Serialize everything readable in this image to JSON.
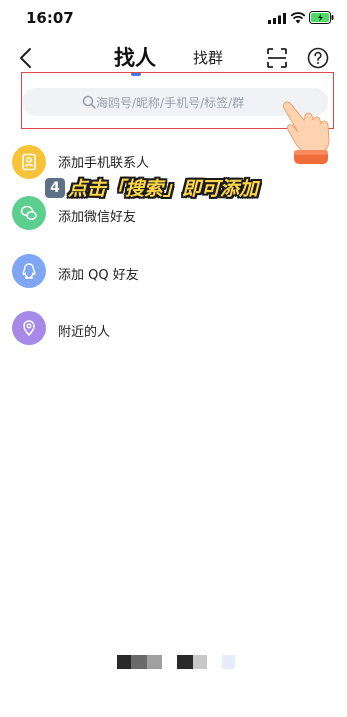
{
  "status_bar": {
    "time": "16:07",
    "battery_color": "#4cd964"
  },
  "header": {
    "title": "找人",
    "secondary_tab": "找群",
    "accent_color": "#4a77e8"
  },
  "search": {
    "placeholder": "海鸥号/昵称/手机号/标签/群",
    "highlight_color": "#e0484e"
  },
  "list": {
    "items": [
      {
        "label": "添加手机联系人",
        "icon": "contacts-icon",
        "color": "#f7c439"
      },
      {
        "label": "添加微信好友",
        "icon": "wechat-icon",
        "color": "#5ccf8f"
      },
      {
        "label": "添加 QQ 好友",
        "icon": "qq-icon",
        "color": "#7ea6f5"
      },
      {
        "label": "附近的人",
        "icon": "location-icon",
        "color": "#a789e8"
      }
    ]
  },
  "overlay": {
    "step_number": "4",
    "caption": "点击「搜索」即可添加",
    "caption_color": "#ffd64a"
  }
}
